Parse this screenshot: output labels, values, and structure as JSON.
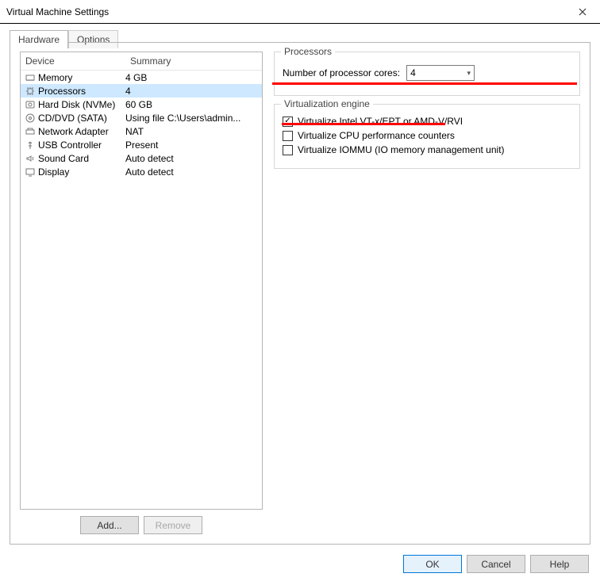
{
  "window": {
    "title": "Virtual Machine Settings"
  },
  "tabs": {
    "hardware": "Hardware",
    "options": "Options"
  },
  "headers": {
    "device": "Device",
    "summary": "Summary"
  },
  "devices": [
    {
      "name": "Memory",
      "summary": "4 GB"
    },
    {
      "name": "Processors",
      "summary": "4"
    },
    {
      "name": "Hard Disk (NVMe)",
      "summary": "60 GB"
    },
    {
      "name": "CD/DVD (SATA)",
      "summary": "Using file C:\\Users\\admin..."
    },
    {
      "name": "Network Adapter",
      "summary": "NAT"
    },
    {
      "name": "USB Controller",
      "summary": "Present"
    },
    {
      "name": "Sound Card",
      "summary": "Auto detect"
    },
    {
      "name": "Display",
      "summary": "Auto detect"
    }
  ],
  "devbuttons": {
    "add": "Add...",
    "remove": "Remove"
  },
  "proc": {
    "group": "Processors",
    "cores_label": "Number of processor cores:",
    "cores_value": "4"
  },
  "venv": {
    "group": "Virtualization engine",
    "vt": "Virtualize Intel VT-x/EPT or AMD-V/RVI",
    "perf": "Virtualize CPU performance counters",
    "iommu": "Virtualize IOMMU (IO memory management unit)"
  },
  "footer": {
    "ok": "OK",
    "cancel": "Cancel",
    "help": "Help"
  }
}
